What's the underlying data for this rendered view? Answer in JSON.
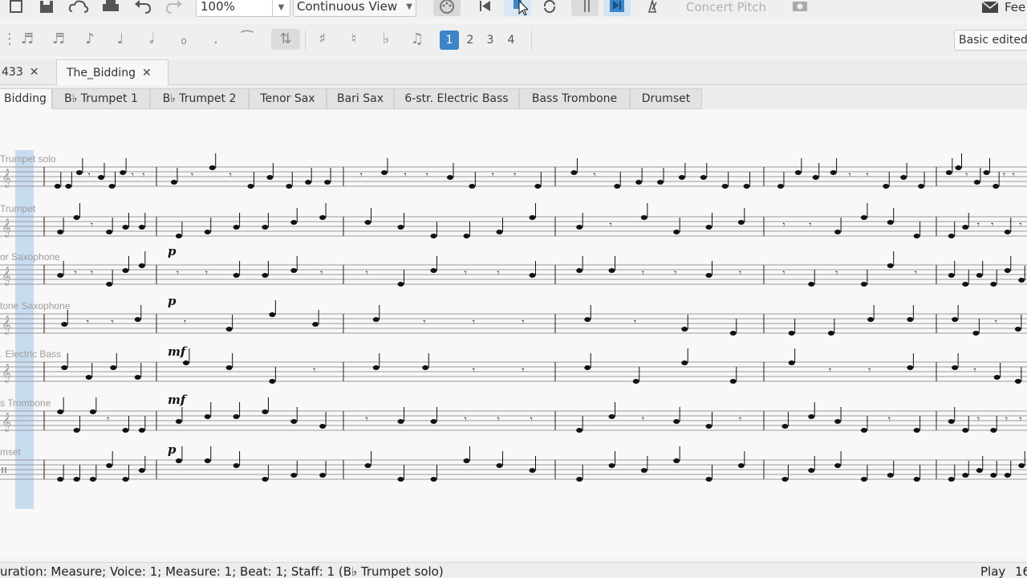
{
  "toolbar": {
    "zoom_value": "100%",
    "view_mode": "Continuous View",
    "concert_pitch_label": "Concert Pitch",
    "feedback_label": "Fee"
  },
  "note_input": {
    "voices": [
      "1",
      "2",
      "3",
      "4"
    ],
    "active_voice": "1",
    "workspace_value": "Basic edited"
  },
  "score_tabs": [
    {
      "label": "433"
    },
    {
      "label": "The_Bidding"
    }
  ],
  "part_tabs": [
    "Bidding",
    "B♭ Trumpet 1",
    "B♭ Trumpet 2",
    "Tenor Sax",
    "Bari Sax",
    "6-str. Electric Bass",
    "Bass Trombone",
    "Drumset"
  ],
  "staves": [
    {
      "name": "Trumpet solo"
    },
    {
      "name": "Trumpet"
    },
    {
      "name": "or Saxophone"
    },
    {
      "name": "tone Saxophone"
    },
    {
      "name": ". Electric Bass"
    },
    {
      "name": "s Trombone"
    },
    {
      "name": "mset"
    }
  ],
  "dynamics": [
    "p",
    "p",
    "mf",
    "mf",
    "p"
  ],
  "status": {
    "message": "uration: Measure; Voice: 1;  Measure: 1; Beat: 1; Staff: 1 (B♭ Trumpet solo)",
    "mode": "Play",
    "position": "16"
  },
  "colors": {
    "accent": "#3b85c8",
    "selection": "#bcd5ee"
  }
}
